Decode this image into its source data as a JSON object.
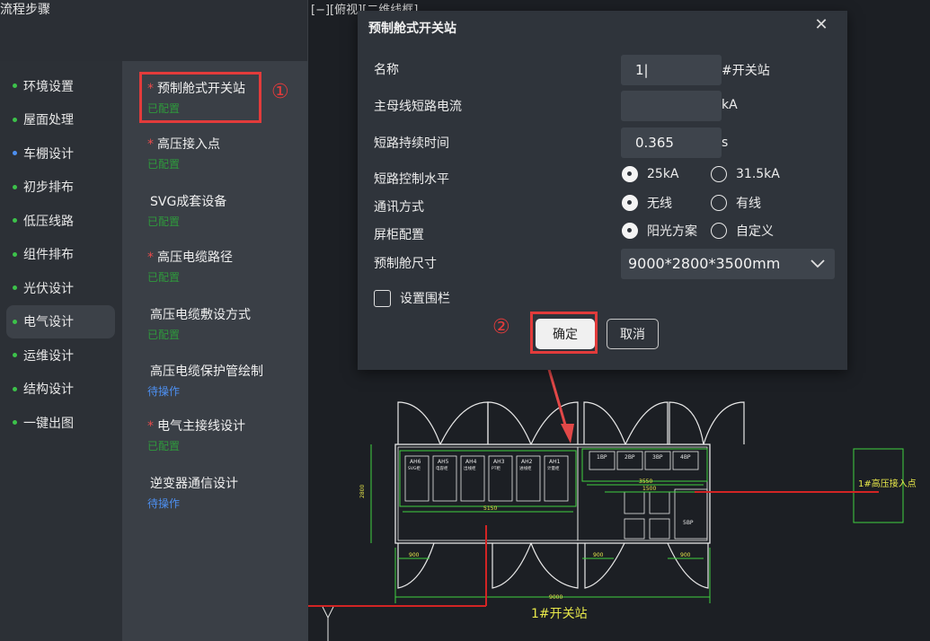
{
  "panel": {
    "title": "流程步骤"
  },
  "nav": {
    "items": [
      {
        "label": "环境设置",
        "dot": "green"
      },
      {
        "label": "屋面处理",
        "dot": "green"
      },
      {
        "label": "车棚设计",
        "dot": "blue"
      },
      {
        "label": "初步排布",
        "dot": "green"
      },
      {
        "label": "低压线路",
        "dot": "green"
      },
      {
        "label": "组件排布",
        "dot": "green"
      },
      {
        "label": "光伏设计",
        "dot": "green"
      },
      {
        "label": "电气设计",
        "dot": "green",
        "active": true
      },
      {
        "label": "运维设计",
        "dot": "green"
      },
      {
        "label": "结构设计",
        "dot": "green"
      },
      {
        "label": "一键出图",
        "dot": "green"
      }
    ]
  },
  "steps": [
    {
      "name": "预制舱式开关站",
      "required": true,
      "status": "已配置",
      "state": "ok"
    },
    {
      "name": "高压接入点",
      "required": true,
      "status": "已配置",
      "state": "ok"
    },
    {
      "name": "SVG成套设备",
      "required": false,
      "status": "已配置",
      "state": "ok"
    },
    {
      "name": "高压电缆路径",
      "required": true,
      "status": "已配置",
      "state": "ok"
    },
    {
      "name": "高压电缆敷设方式",
      "required": false,
      "status": "已配置",
      "state": "ok"
    },
    {
      "name": "高压电缆保护管绘制",
      "required": false,
      "status": "待操作",
      "state": "pending"
    },
    {
      "name": "电气主接线设计",
      "required": true,
      "status": "已配置",
      "state": "ok"
    },
    {
      "name": "逆变器通信设计",
      "required": false,
      "status": "待操作",
      "state": "pending"
    }
  ],
  "annotations": {
    "one": "①",
    "two": "②"
  },
  "viewport": {
    "label": "[−][俯视][二维线框]"
  },
  "dialog": {
    "title": "预制舱式开关站",
    "close": "✕",
    "name_label": "名称",
    "name_value": "1|",
    "name_unit": "#开关站",
    "current_label": "主母线短路电流",
    "current_value": "",
    "current_unit": "kA",
    "duration_label": "短路持续时间",
    "duration_value": "0.365",
    "duration_unit": "s",
    "level_label": "短路控制水平",
    "level_opt1": "25kA",
    "level_opt2": "31.5kA",
    "comm_label": "通讯方式",
    "comm_opt1": "无线",
    "comm_opt2": "有线",
    "cabinet_label": "屏柜配置",
    "cabinet_opt1": "阳光方案",
    "cabinet_opt2": "自定义",
    "size_label": "预制舱尺寸",
    "size_value": "9000*2800*3500mm",
    "fence_label": "设置围栏",
    "ok": "确定",
    "cancel": "取消"
  },
  "cad": {
    "cabinets_top": [
      "AH6",
      "AH5",
      "AH4",
      "AH3",
      "AH2",
      "AH1"
    ],
    "cabinets_top_sub": [
      "SVG柜",
      "电容柜",
      "出线柜",
      "PT柜",
      "进线柜",
      "计量柜"
    ],
    "panels_right": [
      "1BP",
      "2BP",
      "3BP",
      "4BP"
    ],
    "panel_5": "5BP",
    "dim_5150": "5150",
    "dim_9000": "9000",
    "dim_3550": "3550",
    "dim_1500": "1500",
    "dim_2800": "2800",
    "dim_900a": "900",
    "dim_900b": "900",
    "dim_900c": "900",
    "station_label": "1#开关站",
    "hv_label": "1#高压接入点",
    "axis_y": "Y"
  },
  "colors": {
    "accent_red": "#e23b3b",
    "ok_green": "#2f9a3c",
    "pending_blue": "#4d8ff0",
    "cad_green": "#3fd23f",
    "cad_yellow": "#e8e84a"
  }
}
